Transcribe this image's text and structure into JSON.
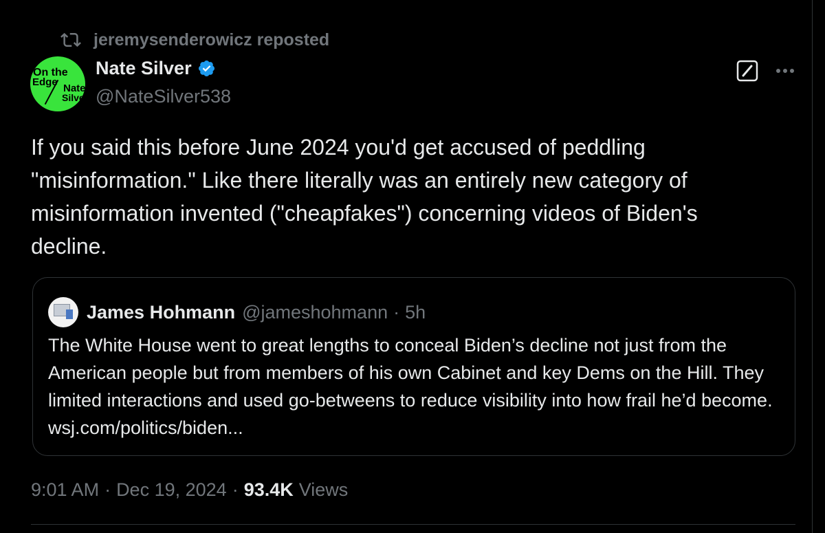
{
  "repost": {
    "label": "jeremysenderowicz reposted",
    "icon": "repost-icon"
  },
  "author": {
    "name": "Nate Silver",
    "handle": "@NateSilver538",
    "verified": true,
    "avatar": {
      "line1": "On the",
      "line2": "Edge",
      "line3": "Nate",
      "line4": "Silver",
      "color": "#39e43c"
    }
  },
  "actions": {
    "grok_icon": "grok-icon",
    "more_icon": "more-icon"
  },
  "tweet": {
    "text": "If you said this before June 2024 you'd get accused of peddling\n\"misinformation.\" Like there literally was an entirely new category of\nmisinformation invented (\"cheapfakes\") concerning videos of Biden's\ndecline."
  },
  "quote": {
    "name": "James Hohmann",
    "handle": "@jameshohmann",
    "separator": "·",
    "time": "5h",
    "text": "The White House went to great lengths to conceal Biden’s decline not just from the American people but from members of his own Cabinet and key Dems on the Hill. They limited interactions and used go-betweens to reduce visibility into how frail he’d become. wsj.com/politics/biden..."
  },
  "meta": {
    "time": "9:01 AM",
    "sep1": "·",
    "date": "Dec 19, 2024",
    "sep2": "·",
    "views_count": "93.4K",
    "views_label": "Views"
  },
  "colors": {
    "background": "#000000",
    "text": "#e7e9ea",
    "muted": "#71767b",
    "border": "#2f3336",
    "verified": "#1d9bf0"
  }
}
